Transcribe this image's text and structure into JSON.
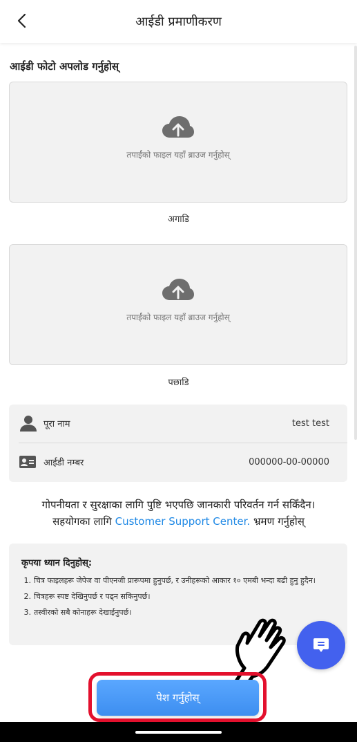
{
  "header": {
    "title": "आईडी प्रमाणीकरण",
    "back_icon": "chevron-left-icon"
  },
  "upload": {
    "section_title": "आईडी फोटो अपलोड गर्नुहोस्",
    "front": {
      "hint": "तपाईंको फाइल यहाँ ब्राउज गर्नुहोस्",
      "caption": "अगाडि",
      "icon": "cloud-upload-icon"
    },
    "back": {
      "hint": "तपाईंको फाइल यहाँ ब्राउज गर्नुहोस्",
      "caption": "पछाडि",
      "icon": "cloud-upload-icon"
    }
  },
  "info": {
    "full_name": {
      "label": "पूरा नाम",
      "value": "test test",
      "icon": "user-icon"
    },
    "id_number": {
      "label": "आईडी नम्बर",
      "value": "000000-00-00000",
      "icon": "id-card-icon"
    }
  },
  "notice": {
    "line1": "गोपनीयता र सुरक्षाका लागि पुष्टि भएपछि जानकारी परिवर्तन गर्न सकिँदैन।",
    "line2_prefix": "सहयोगका लागि",
    "link_text": "Customer Support Center.",
    "line2_suffix": "भ्रमण गर्नुहोस्"
  },
  "note": {
    "title": "कृपया ध्यान दिनुहोस्:",
    "items": [
      {
        "num": "1.",
        "text": "चित्र फाइलहरू जेपेज वा पीएनजी प्रारूपमा हुनुपर्छ, र उनीहरूको आकार १० एमबी भन्दा बढी हुनु हुदैन।"
      },
      {
        "num": "2.",
        "text": "चित्रहरू स्पष्ट देखिनुपर्छ र पढ्न सकिनुपर्छ।"
      },
      {
        "num": "3.",
        "text": "तस्वीरको सबै कोनाहरू देखाईनुपर्छ।"
      }
    ]
  },
  "submit": {
    "label": "पेश गर्नुहोस्"
  },
  "colors": {
    "accent": "#3d8ef0",
    "link": "#1e88e5",
    "fab": "#4361ee",
    "highlight": "#e3102d",
    "panel": "#f2f2f2"
  }
}
